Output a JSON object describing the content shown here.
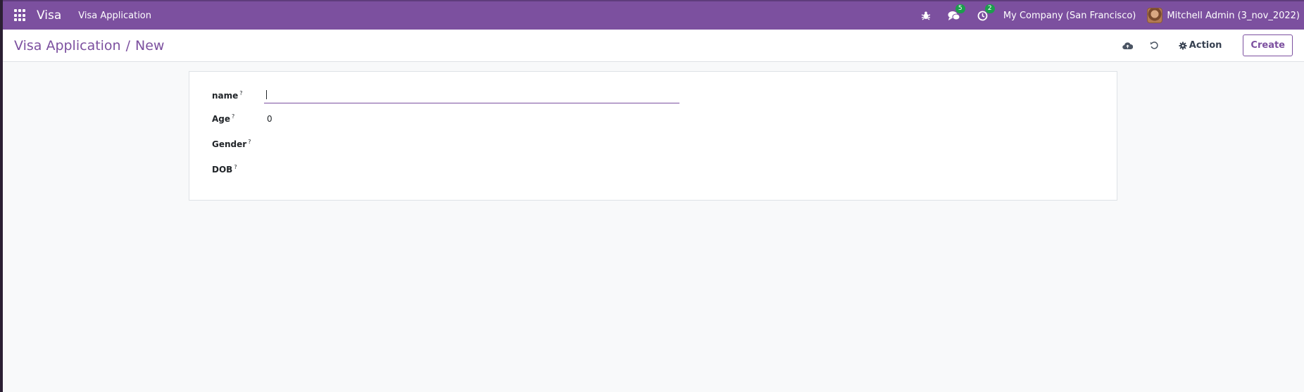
{
  "navbar": {
    "brand": "Visa",
    "menu_item": "Visa Application",
    "messages_count": "5",
    "activities_count": "2",
    "company": "My Company (San Francisco)",
    "user": "Mitchell Admin (3_nov_2022)",
    "accent_color": "#7c509f",
    "badge_color": "#1b9e4c"
  },
  "breadcrumb": {
    "parent": "Visa Application",
    "separator": "/",
    "current": "New"
  },
  "control_panel": {
    "save_icon": "cloud-upload-icon",
    "discard_icon": "undo-icon",
    "action_label": "Action",
    "create_label": "Create"
  },
  "form": {
    "help_marker": "?",
    "fields": {
      "name": {
        "label": "name",
        "value": ""
      },
      "age": {
        "label": "Age",
        "value": "0"
      },
      "gender": {
        "label": "Gender",
        "value": ""
      },
      "dob": {
        "label": "DOB",
        "value": ""
      }
    }
  }
}
